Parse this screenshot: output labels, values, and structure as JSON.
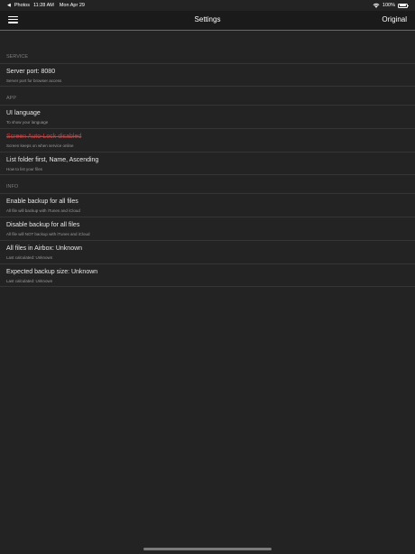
{
  "status_bar": {
    "back_arrow": "◀",
    "back_app": "Photos",
    "time": "11:28 AM",
    "date": "Mon Apr 29",
    "battery_percent": "100%",
    "wifi_icon": "wifi-icon",
    "battery_icon": "battery-icon"
  },
  "nav": {
    "menu_icon": "hamburger-menu-icon",
    "title": "Settings",
    "right_button": "Original",
    "accent_color": "#3a8a3a"
  },
  "sections": {
    "service": {
      "header": "SERVICE",
      "items": [
        {
          "title": "Server port: 8080",
          "subtitle": "Server port for browser access"
        }
      ]
    },
    "app": {
      "header": "APP",
      "items": [
        {
          "title": "UI language",
          "subtitle": "To show your language"
        },
        {
          "title": "Screen Auto-Lock disabled",
          "subtitle": "Screen keeps on when service online",
          "status_color": "#d63a3a"
        },
        {
          "title": "List folder first, Name, Ascending",
          "subtitle": "How to list your files"
        }
      ]
    },
    "info": {
      "header": "INFO",
      "items": [
        {
          "title": "Enable backup for all files",
          "subtitle": "All file will backup with iTunes and iCloud"
        },
        {
          "title": "Disable backup for all files",
          "subtitle": "All file will NOT backup with iTunes and iCloud"
        },
        {
          "title": "All files in Airbox: Unknown",
          "subtitle": "Last calculated: Unknown"
        },
        {
          "title": "Expected backup size: Unknown",
          "subtitle": "Last calculated: Unknown"
        }
      ]
    }
  }
}
